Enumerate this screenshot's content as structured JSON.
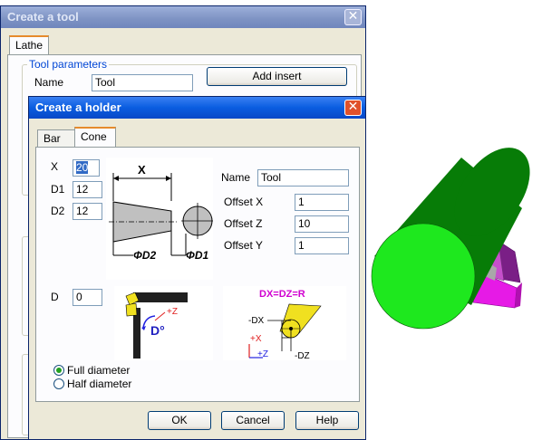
{
  "tool_window": {
    "title": "Create a tool",
    "tab": "Lathe",
    "group_label": "Tool parameters",
    "name_label": "Name",
    "name_value": "Tool",
    "add_insert_label": "Add insert"
  },
  "holder_window": {
    "title": "Create a holder",
    "tabs": {
      "bar": "Bar",
      "cone": "Cone"
    },
    "fields": {
      "x": {
        "label": "X",
        "value": "20"
      },
      "d1": {
        "label": "D1",
        "value": "12"
      },
      "d2": {
        "label": "D2",
        "value": "12"
      },
      "d": {
        "label": "D",
        "value": "0"
      }
    },
    "name_label": "Name",
    "name_value": "Tool",
    "offset_x": {
      "label": "Offset X",
      "value": "1"
    },
    "offset_z": {
      "label": "Offset Z",
      "value": "10"
    },
    "offset_y": {
      "label": "Offset Y",
      "value": "1"
    },
    "diagram_labels": {
      "x": "X",
      "d2": "ΦD2",
      "d1": "ΦD1",
      "d_angle": "D°",
      "plus_z": "+Z",
      "dx_eq": "DX=DZ=R",
      "minus_dx": "-DX",
      "plus_x": "+X",
      "plus_z2": "+Z",
      "minus_dz": "-DZ"
    },
    "options": {
      "full_diameter": "Full diameter",
      "half_diameter": "Half diameter",
      "selected": "full_diameter"
    },
    "buttons": {
      "ok": "OK",
      "cancel": "Cancel",
      "help": "Help"
    }
  },
  "colors": {
    "cylinder_side": "#077c07",
    "cylinder_face": "#1ee81e",
    "insert_magenta": "#e61ae6",
    "insert_purple": "#7a1f86",
    "label_magenta": "#d000d0",
    "diagram_yellow": "#f0e020",
    "axis_red": "#e02020",
    "axis_blue": "#2020e0"
  }
}
